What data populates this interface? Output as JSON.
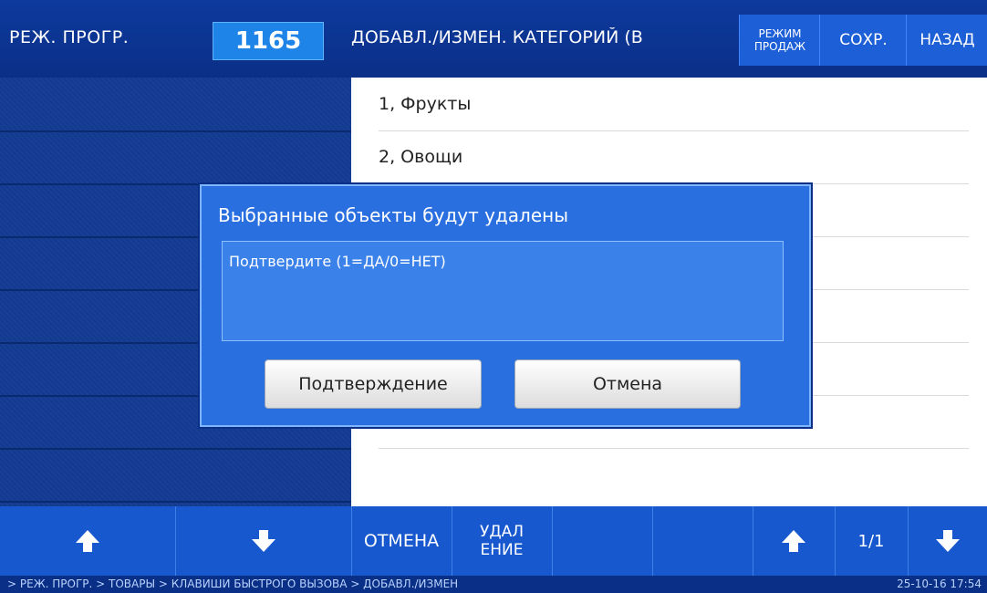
{
  "header": {
    "mode_label": "РЕЖ. ПРОГР.",
    "code": "1165",
    "title": "ДОБАВЛ./ИЗМЕН. КАТЕГОРИЙ (В",
    "sale_mode_line1": "РЕЖИМ",
    "sale_mode_line2": "ПРОДАЖ",
    "save_label": "СОХР.",
    "back_label": "НАЗАД"
  },
  "list": {
    "items": [
      "1, Фрукты",
      "2, Овощи"
    ]
  },
  "dialog": {
    "title": "Выбранные объекты будут удалены",
    "message": "Подтвердите (1=ДА/0=НЕТ)",
    "confirm_label": "Подтверждение",
    "cancel_label": "Отмена"
  },
  "toolbar": {
    "cancel_label": "ОТМЕНА",
    "delete_line1": "УДАЛ",
    "delete_line2": "ЕНИЕ",
    "page_indicator": "1/1"
  },
  "status": {
    "breadcrumb": "> РЕЖ. ПРОГР. > ТОВАРЫ > КЛАВИШИ БЫСТРОГО ВЫЗОВА > ДОБАВЛ./ИЗМЕН",
    "datetime": "25-10-16  17:54"
  },
  "colors": {
    "header_bg": "#0e3a9e",
    "accent_blue": "#1e84e8",
    "dialog_bg": "#2a6fe0",
    "toolbar_bg": "#1758cf"
  }
}
